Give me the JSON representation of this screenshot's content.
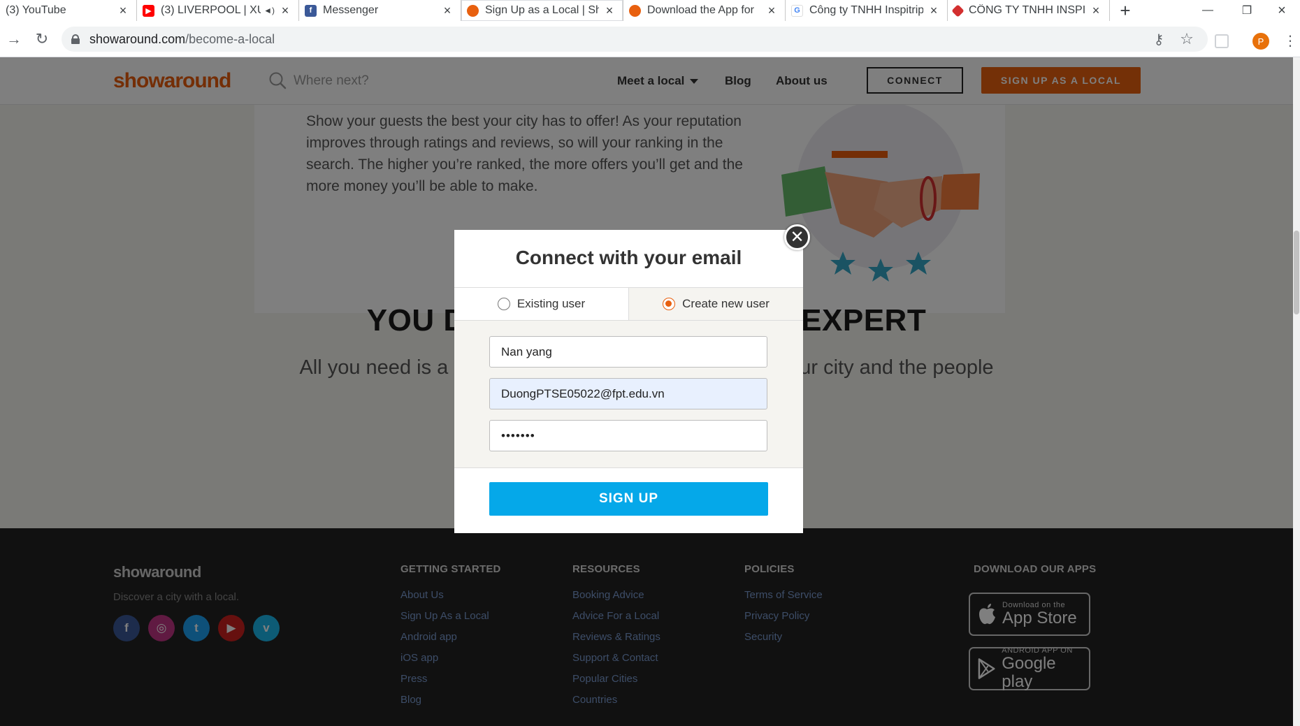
{
  "browser": {
    "tabs": [
      {
        "label": "(3) YouTube",
        "favicon": "none",
        "active": false
      },
      {
        "label": "(3) LIVERPOOL | XU",
        "favicon": "youtube-icon",
        "color": "#ff0000",
        "muted": true,
        "active": false
      },
      {
        "label": "Messenger",
        "favicon": "facebook-icon",
        "color": "#3b5998",
        "active": false
      },
      {
        "label": "Sign Up as a Local | Sh",
        "favicon": "showaround-icon",
        "color": "#e8600f",
        "active": true
      },
      {
        "label": "Download the App for",
        "favicon": "showaround-icon",
        "color": "#e8600f",
        "active": false
      },
      {
        "label": "Công ty TNHH Inspitrip",
        "favicon": "google-icon",
        "color": "#4285f4",
        "active": false
      },
      {
        "label": "CÔNG TY TNHH INSPI",
        "favicon": "inspitrip-icon",
        "color": "#d32f2f",
        "active": false
      }
    ],
    "url_host": "showaround.com",
    "url_path": "/become-a-local",
    "profile_initial": "P",
    "glyphs": {
      "close": "×",
      "new_tab": "+",
      "minimize": "—",
      "restore": "❐",
      "back": "→",
      "reload": "↻",
      "key": "⚷",
      "star": "☆",
      "menu": "⋮",
      "mute": "◄)",
      "modal_close": "✕"
    }
  },
  "header": {
    "logo": "showaround",
    "search_placeholder": "Where next?",
    "nav": {
      "meet": "Meet a local",
      "blog": "Blog",
      "about": "About us"
    },
    "connect": "CONNECT",
    "signup_local": "SIGN UP AS A LOCAL"
  },
  "content": {
    "card_text": "Show your guests the best your city has to offer! As your reputation improves through ratings and reviews, so will your ranking in the search. The higher you’re ranked, the more offers you’ll get and the more money you’ll be able to make.",
    "headline": "YOU DON'T NEED TO BE AN EXPERT",
    "subline": "All you need is a passion for travel and knowledge of your city and the people you show around."
  },
  "modal": {
    "title": "Connect with your email",
    "tab_existing": "Existing user",
    "tab_new": "Create new user",
    "selected_tab": "new",
    "name_value": "Nan yang",
    "email_value": "DuongPTSE05022@fpt.edu.vn",
    "password_value": "•••••••",
    "submit": "SIGN UP"
  },
  "footer": {
    "logo": "showaround",
    "tagline": "Discover a city with a local.",
    "social": [
      "facebook-icon",
      "instagram-icon",
      "twitter-icon",
      "youtube-icon",
      "vimeo-icon"
    ],
    "social_glyphs": [
      "f",
      "◎",
      "t",
      "▶",
      "v"
    ],
    "getting_started": {
      "title": "GETTING STARTED",
      "links": [
        "About Us",
        "Sign Up As a Local",
        "Android app",
        "iOS app",
        "Press",
        "Blog"
      ]
    },
    "resources": {
      "title": "RESOURCES",
      "links": [
        "Booking Advice",
        "Advice For a Local",
        "Reviews & Ratings",
        "Support & Contact",
        "Popular Cities",
        "Countries"
      ]
    },
    "policies": {
      "title": "POLICIES",
      "links": [
        "Terms of Service",
        "Privacy Policy",
        "Security"
      ]
    },
    "apps": {
      "title": "DOWNLOAD OUR APPS",
      "appstore_small": "Download on the",
      "appstore_big": "App Store",
      "play_small": "ANDROID APP ON",
      "play_big": "Google play"
    }
  },
  "colors": {
    "brand": "#e85d0c",
    "signup_button": "#05a8e9",
    "footer_bg": "#222222"
  }
}
